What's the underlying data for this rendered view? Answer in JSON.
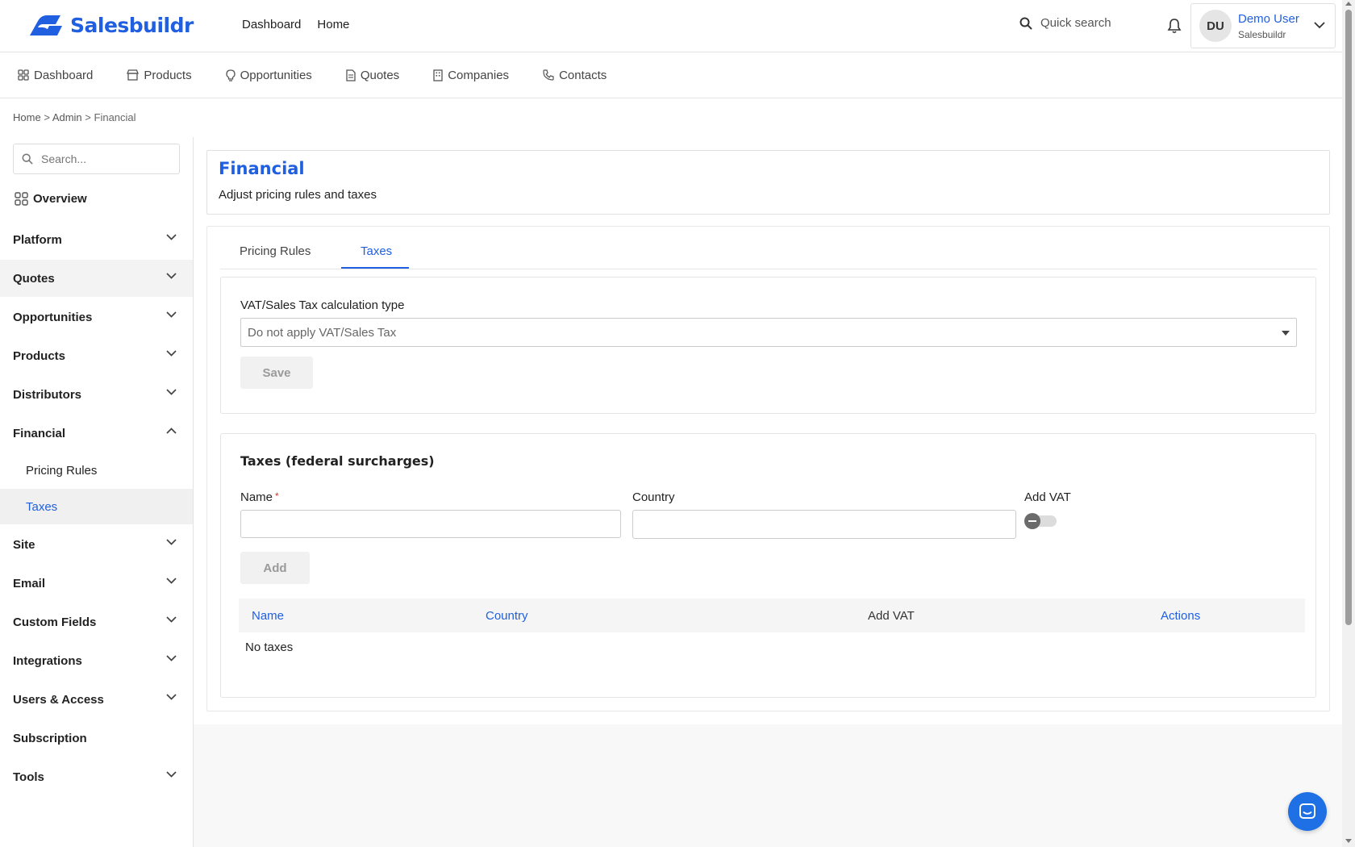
{
  "brand": {
    "name": "Salesbuildr",
    "color": "#1f5fe0"
  },
  "topnav": {
    "dashboard": "Dashboard",
    "home": "Home"
  },
  "quick_search": {
    "label": "Quick search"
  },
  "user": {
    "initials": "DU",
    "name": "Demo User",
    "org": "Salesbuildr"
  },
  "subnav": [
    {
      "label": "Dashboard",
      "icon": "grid-icon"
    },
    {
      "label": "Products",
      "icon": "store-icon"
    },
    {
      "label": "Opportunities",
      "icon": "lightbulb-icon"
    },
    {
      "label": "Quotes",
      "icon": "document-icon"
    },
    {
      "label": "Companies",
      "icon": "building-icon"
    },
    {
      "label": "Contacts",
      "icon": "phone-icon"
    }
  ],
  "breadcrumb": {
    "home": "Home",
    "sep": ">",
    "admin": "Admin",
    "current": "Financial"
  },
  "sidebar": {
    "search_placeholder": "Search...",
    "overview": "Overview",
    "items": [
      "Platform",
      "Quotes",
      "Opportunities",
      "Products",
      "Distributors",
      "Financial",
      "Site",
      "Email",
      "Custom Fields",
      "Integrations",
      "Users & Access",
      "Subscription",
      "Tools"
    ],
    "financial_children": [
      "Pricing Rules",
      "Taxes"
    ],
    "selected_child": "Taxes"
  },
  "page": {
    "title": "Financial",
    "subtitle": "Adjust pricing rules and taxes"
  },
  "tabs": {
    "pricing_rules": "Pricing Rules",
    "taxes": "Taxes",
    "active": "Taxes"
  },
  "vat_form": {
    "label": "VAT/Sales Tax calculation type",
    "selected": "Do not apply VAT/Sales Tax",
    "save_label": "Save"
  },
  "taxes_section": {
    "title": "Taxes (federal surcharges)",
    "name_label": "Name",
    "required_mark": "*",
    "country_label": "Country",
    "add_vat_label": "Add VAT",
    "add_vat_on": false,
    "add_label": "Add",
    "table": {
      "headers": {
        "name": "Name",
        "country": "Country",
        "add_vat": "Add VAT",
        "actions": "Actions"
      },
      "empty": "No taxes"
    }
  }
}
